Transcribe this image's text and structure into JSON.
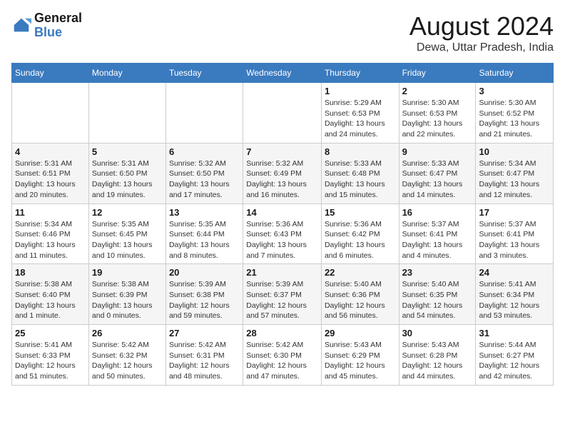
{
  "logo": {
    "text_general": "General",
    "text_blue": "Blue"
  },
  "title": {
    "month_year": "August 2024",
    "location": "Dewa, Uttar Pradesh, India"
  },
  "headers": [
    "Sunday",
    "Monday",
    "Tuesday",
    "Wednesday",
    "Thursday",
    "Friday",
    "Saturday"
  ],
  "weeks": [
    [
      {
        "day": "",
        "info": ""
      },
      {
        "day": "",
        "info": ""
      },
      {
        "day": "",
        "info": ""
      },
      {
        "day": "",
        "info": ""
      },
      {
        "day": "1",
        "info": "Sunrise: 5:29 AM\nSunset: 6:53 PM\nDaylight: 13 hours\nand 24 minutes."
      },
      {
        "day": "2",
        "info": "Sunrise: 5:30 AM\nSunset: 6:53 PM\nDaylight: 13 hours\nand 22 minutes."
      },
      {
        "day": "3",
        "info": "Sunrise: 5:30 AM\nSunset: 6:52 PM\nDaylight: 13 hours\nand 21 minutes."
      }
    ],
    [
      {
        "day": "4",
        "info": "Sunrise: 5:31 AM\nSunset: 6:51 PM\nDaylight: 13 hours\nand 20 minutes."
      },
      {
        "day": "5",
        "info": "Sunrise: 5:31 AM\nSunset: 6:50 PM\nDaylight: 13 hours\nand 19 minutes."
      },
      {
        "day": "6",
        "info": "Sunrise: 5:32 AM\nSunset: 6:50 PM\nDaylight: 13 hours\nand 17 minutes."
      },
      {
        "day": "7",
        "info": "Sunrise: 5:32 AM\nSunset: 6:49 PM\nDaylight: 13 hours\nand 16 minutes."
      },
      {
        "day": "8",
        "info": "Sunrise: 5:33 AM\nSunset: 6:48 PM\nDaylight: 13 hours\nand 15 minutes."
      },
      {
        "day": "9",
        "info": "Sunrise: 5:33 AM\nSunset: 6:47 PM\nDaylight: 13 hours\nand 14 minutes."
      },
      {
        "day": "10",
        "info": "Sunrise: 5:34 AM\nSunset: 6:47 PM\nDaylight: 13 hours\nand 12 minutes."
      }
    ],
    [
      {
        "day": "11",
        "info": "Sunrise: 5:34 AM\nSunset: 6:46 PM\nDaylight: 13 hours\nand 11 minutes."
      },
      {
        "day": "12",
        "info": "Sunrise: 5:35 AM\nSunset: 6:45 PM\nDaylight: 13 hours\nand 10 minutes."
      },
      {
        "day": "13",
        "info": "Sunrise: 5:35 AM\nSunset: 6:44 PM\nDaylight: 13 hours\nand 8 minutes."
      },
      {
        "day": "14",
        "info": "Sunrise: 5:36 AM\nSunset: 6:43 PM\nDaylight: 13 hours\nand 7 minutes."
      },
      {
        "day": "15",
        "info": "Sunrise: 5:36 AM\nSunset: 6:42 PM\nDaylight: 13 hours\nand 6 minutes."
      },
      {
        "day": "16",
        "info": "Sunrise: 5:37 AM\nSunset: 6:41 PM\nDaylight: 13 hours\nand 4 minutes."
      },
      {
        "day": "17",
        "info": "Sunrise: 5:37 AM\nSunset: 6:41 PM\nDaylight: 13 hours\nand 3 minutes."
      }
    ],
    [
      {
        "day": "18",
        "info": "Sunrise: 5:38 AM\nSunset: 6:40 PM\nDaylight: 13 hours\nand 1 minute."
      },
      {
        "day": "19",
        "info": "Sunrise: 5:38 AM\nSunset: 6:39 PM\nDaylight: 13 hours\nand 0 minutes."
      },
      {
        "day": "20",
        "info": "Sunrise: 5:39 AM\nSunset: 6:38 PM\nDaylight: 12 hours\nand 59 minutes."
      },
      {
        "day": "21",
        "info": "Sunrise: 5:39 AM\nSunset: 6:37 PM\nDaylight: 12 hours\nand 57 minutes."
      },
      {
        "day": "22",
        "info": "Sunrise: 5:40 AM\nSunset: 6:36 PM\nDaylight: 12 hours\nand 56 minutes."
      },
      {
        "day": "23",
        "info": "Sunrise: 5:40 AM\nSunset: 6:35 PM\nDaylight: 12 hours\nand 54 minutes."
      },
      {
        "day": "24",
        "info": "Sunrise: 5:41 AM\nSunset: 6:34 PM\nDaylight: 12 hours\nand 53 minutes."
      }
    ],
    [
      {
        "day": "25",
        "info": "Sunrise: 5:41 AM\nSunset: 6:33 PM\nDaylight: 12 hours\nand 51 minutes."
      },
      {
        "day": "26",
        "info": "Sunrise: 5:42 AM\nSunset: 6:32 PM\nDaylight: 12 hours\nand 50 minutes."
      },
      {
        "day": "27",
        "info": "Sunrise: 5:42 AM\nSunset: 6:31 PM\nDaylight: 12 hours\nand 48 minutes."
      },
      {
        "day": "28",
        "info": "Sunrise: 5:42 AM\nSunset: 6:30 PM\nDaylight: 12 hours\nand 47 minutes."
      },
      {
        "day": "29",
        "info": "Sunrise: 5:43 AM\nSunset: 6:29 PM\nDaylight: 12 hours\nand 45 minutes."
      },
      {
        "day": "30",
        "info": "Sunrise: 5:43 AM\nSunset: 6:28 PM\nDaylight: 12 hours\nand 44 minutes."
      },
      {
        "day": "31",
        "info": "Sunrise: 5:44 AM\nSunset: 6:27 PM\nDaylight: 12 hours\nand 42 minutes."
      }
    ]
  ]
}
